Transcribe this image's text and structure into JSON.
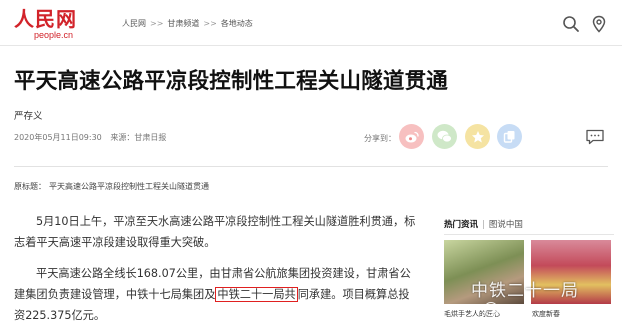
{
  "header": {
    "logo_main": "人民网",
    "logo_sub": "people.cn",
    "breadcrumb": [
      "人民网",
      "甘肃频道",
      "各地动态"
    ],
    "breadcrumb_separator": ">>"
  },
  "article": {
    "title": "平天高速公路平凉段控制性工程关山隧道贯通",
    "author": "严存义",
    "date": "2020年05月11日09:30",
    "source": "来源：甘肃日报",
    "share_label": "分享到：",
    "original_title_label": "原标题：",
    "original_title": "平天高速公路平凉段控制性工程关山隧道贯通",
    "paragraph1": "5月10日上午，平凉至天水高速公路平凉段控制性工程关山隧道胜利贯通，标志着平天高速平凉段建设取得重大突破。",
    "paragraph2_before": "平天高速公路全线长168.07公里，由甘肃省公航旅集团投资建设，甘肃省公建集团负责建设管理，中铁十七局集团及",
    "paragraph2_highlight": "中铁二十一局共",
    "paragraph2_after": "同承建。项目概算总投资225.375亿元。"
  },
  "sidebar": {
    "tab_active": "热门资讯",
    "tab_other": "图说中国",
    "captions": [
      "毛烘手艺人的匠心",
      "欢度新春"
    ]
  },
  "watermark": "中铁二十一局",
  "colors": {
    "brand_red": "#d2232a",
    "highlight_border": "#e02020"
  }
}
